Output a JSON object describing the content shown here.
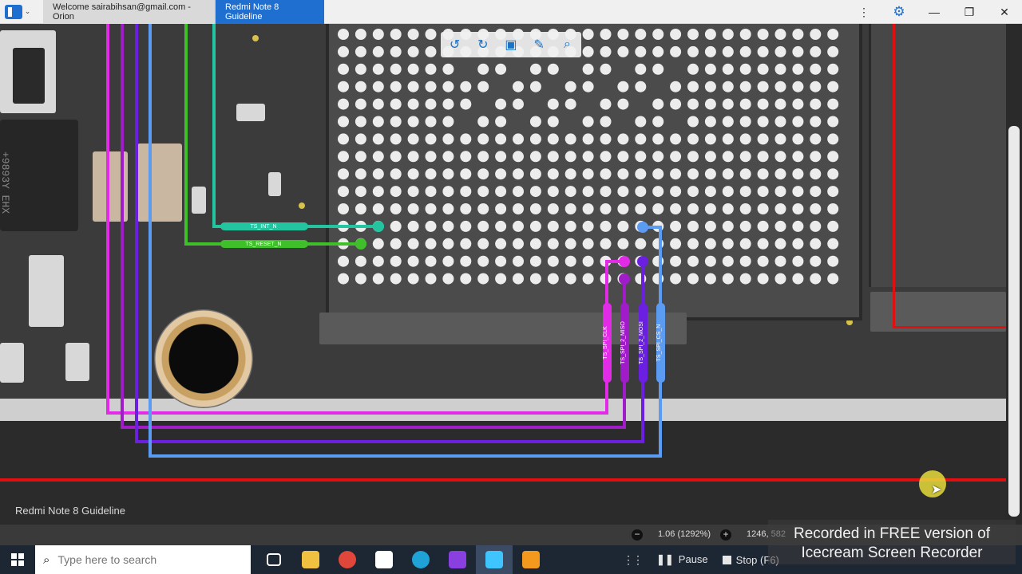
{
  "window": {
    "tabs": [
      {
        "label": "Welcome sairabihsan@gmail.com - Orion",
        "active": false
      },
      {
        "label": "Redmi Note 8 Guideline",
        "active": true
      }
    ],
    "icons": {
      "app_menu": "sidebar-toggle-icon",
      "more": "more-vertical-icon",
      "settings": "gear-icon",
      "minimize": "minimize-icon",
      "maximize": "restore-icon",
      "close": "close-icon"
    },
    "glyphs": {
      "more": "⋮",
      "settings": "⚙",
      "minimize": "—",
      "maximize": "❐",
      "close": "✕"
    }
  },
  "toolbar": {
    "tools": [
      {
        "name": "rotate-left-icon",
        "glyph": "↺"
      },
      {
        "name": "rotate-right-icon",
        "glyph": "↻"
      },
      {
        "name": "fit-screen-icon",
        "glyph": "▣"
      },
      {
        "name": "draw-tool-icon",
        "glyph": "✎"
      },
      {
        "name": "search-icon",
        "glyph": "⌕"
      }
    ]
  },
  "board": {
    "label": "Redmi Note 8 Guideline",
    "chip_marking": "+9893Y EHX K",
    "signals": [
      {
        "label": "TS_INT_N",
        "color": "#25c4a0"
      },
      {
        "label": "TS_RESET_N",
        "color": "#3fbf2a"
      },
      {
        "label": "TS_SPI_CLK",
        "color": "#e12be6"
      },
      {
        "label": "TS_SPI_2_MISO",
        "color": "#a01cc9"
      },
      {
        "label": "TS_SPI_2_MOSI",
        "color": "#6b1fe0"
      },
      {
        "label": "TS_SPI_CS_N",
        "color": "#5b9cf2"
      }
    ],
    "guide_line_color": "#e01010"
  },
  "status": {
    "zoom_minus": "−",
    "zoom_plus": "+",
    "zoom": "1.06 (1292%)",
    "coords": "1246, 582"
  },
  "watermark": {
    "line1": "Recorded in FREE version of",
    "line2": "Icecream  Screen  Recorder"
  },
  "taskbar": {
    "search_placeholder": "Type here to search",
    "apps": [
      {
        "name": "task-view-icon",
        "color": "#ffffff"
      },
      {
        "name": "file-explorer-icon",
        "color": "#f0c040"
      },
      {
        "name": "chrome-icon",
        "color": "#e0463a"
      },
      {
        "name": "capcut-icon",
        "color": "#ffffff"
      },
      {
        "name": "edge-icon",
        "color": "#1fa3d6"
      },
      {
        "name": "video-editor-icon",
        "color": "#8a3fe0"
      },
      {
        "name": "orion-icon",
        "color": "#3ec4ff"
      },
      {
        "name": "icecream-recorder-icon",
        "color": "#f39a1e"
      }
    ],
    "recorder": {
      "pause": "Pause",
      "stop": "Stop",
      "stop_hint": "(F6)"
    }
  }
}
